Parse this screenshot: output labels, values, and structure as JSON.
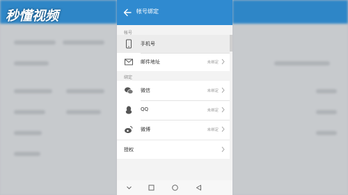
{
  "watermark": "秒懂视频",
  "header": {
    "title": "帐号绑定"
  },
  "sections": {
    "account_label": "帐号",
    "bind_label": "绑定"
  },
  "account_rows": [
    {
      "label": "手机号",
      "icon": "phone-icon"
    },
    {
      "label": "邮件地址",
      "status": "未绑定",
      "icon": "mail-icon"
    }
  ],
  "bind_rows": [
    {
      "label": "微信",
      "status": "未绑定",
      "icon": "wechat-icon"
    },
    {
      "label": "QQ",
      "status": "未绑定",
      "icon": "qq-icon"
    },
    {
      "label": "微博",
      "status": "未绑定",
      "icon": "weibo-icon"
    }
  ],
  "other_row": {
    "label": "授权"
  },
  "navbar": [
    "back-triangle-icon",
    "home-circle-icon",
    "recents-square-icon",
    "dropdown-icon"
  ],
  "colors": {
    "titlebar": "#2f8ad0",
    "background": "#f3f3f3"
  }
}
